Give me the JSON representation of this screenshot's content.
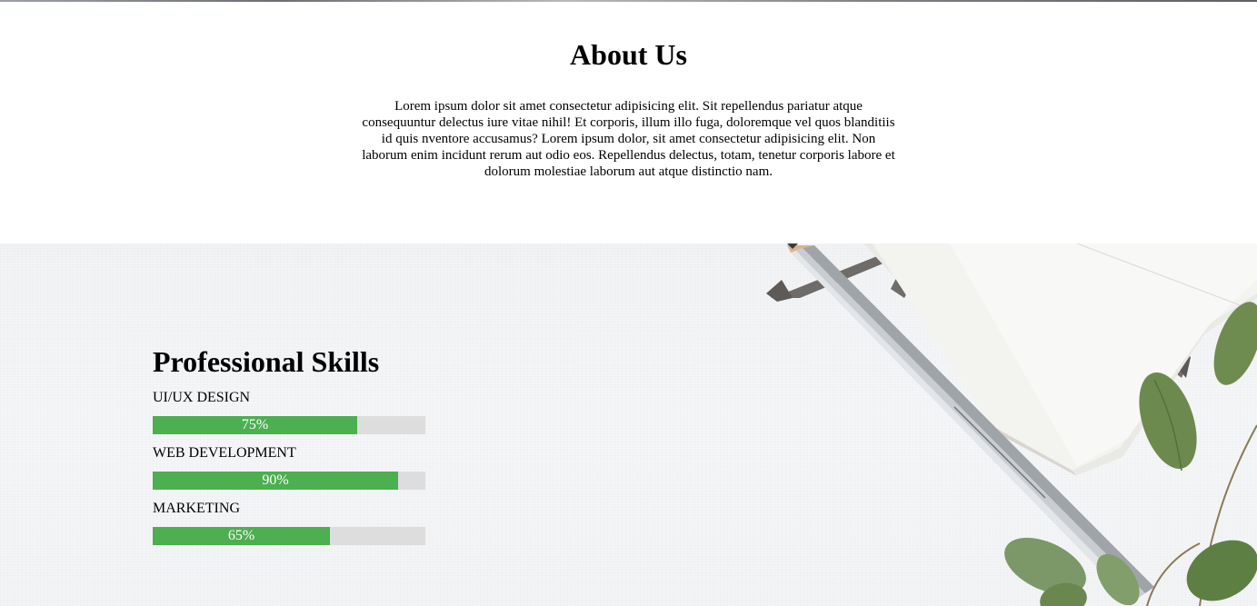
{
  "about": {
    "title": "About Us",
    "body": "Lorem ipsum dolor sit amet consectetur adipisicing elit. Sit repellendus pariatur atque consequuntur delectus iure vitae nihil! Et corporis, illum illo fuga, doloremque vel quos blanditiis id quis nventore accusamus? Lorem ipsum dolor, sit amet consectetur adipisicing elit. Non laborum enim incidunt rerum aut odio eos. Repellendus delectus, totam, tenetur corporis labore et dolorum molestiae laborum aut atque distinctio nam."
  },
  "skills": {
    "title": "Professional Skills",
    "items": [
      {
        "name": "UI/UX DESIGN",
        "percent_label": "75%",
        "value": 75
      },
      {
        "name": "WEB DEVELOPMENT",
        "percent_label": "90%",
        "value": 90
      },
      {
        "name": "MARKETING",
        "percent_label": "65%",
        "value": 65
      }
    ]
  },
  "colors": {
    "bar_fill": "#4caf50",
    "bar_track": "#dddddd",
    "section_background": "#f3f4f6"
  },
  "background_image": {
    "depicts": [
      "pencil",
      "notebook",
      "ribbon-bookmark",
      "eucalyptus-leaves"
    ]
  }
}
